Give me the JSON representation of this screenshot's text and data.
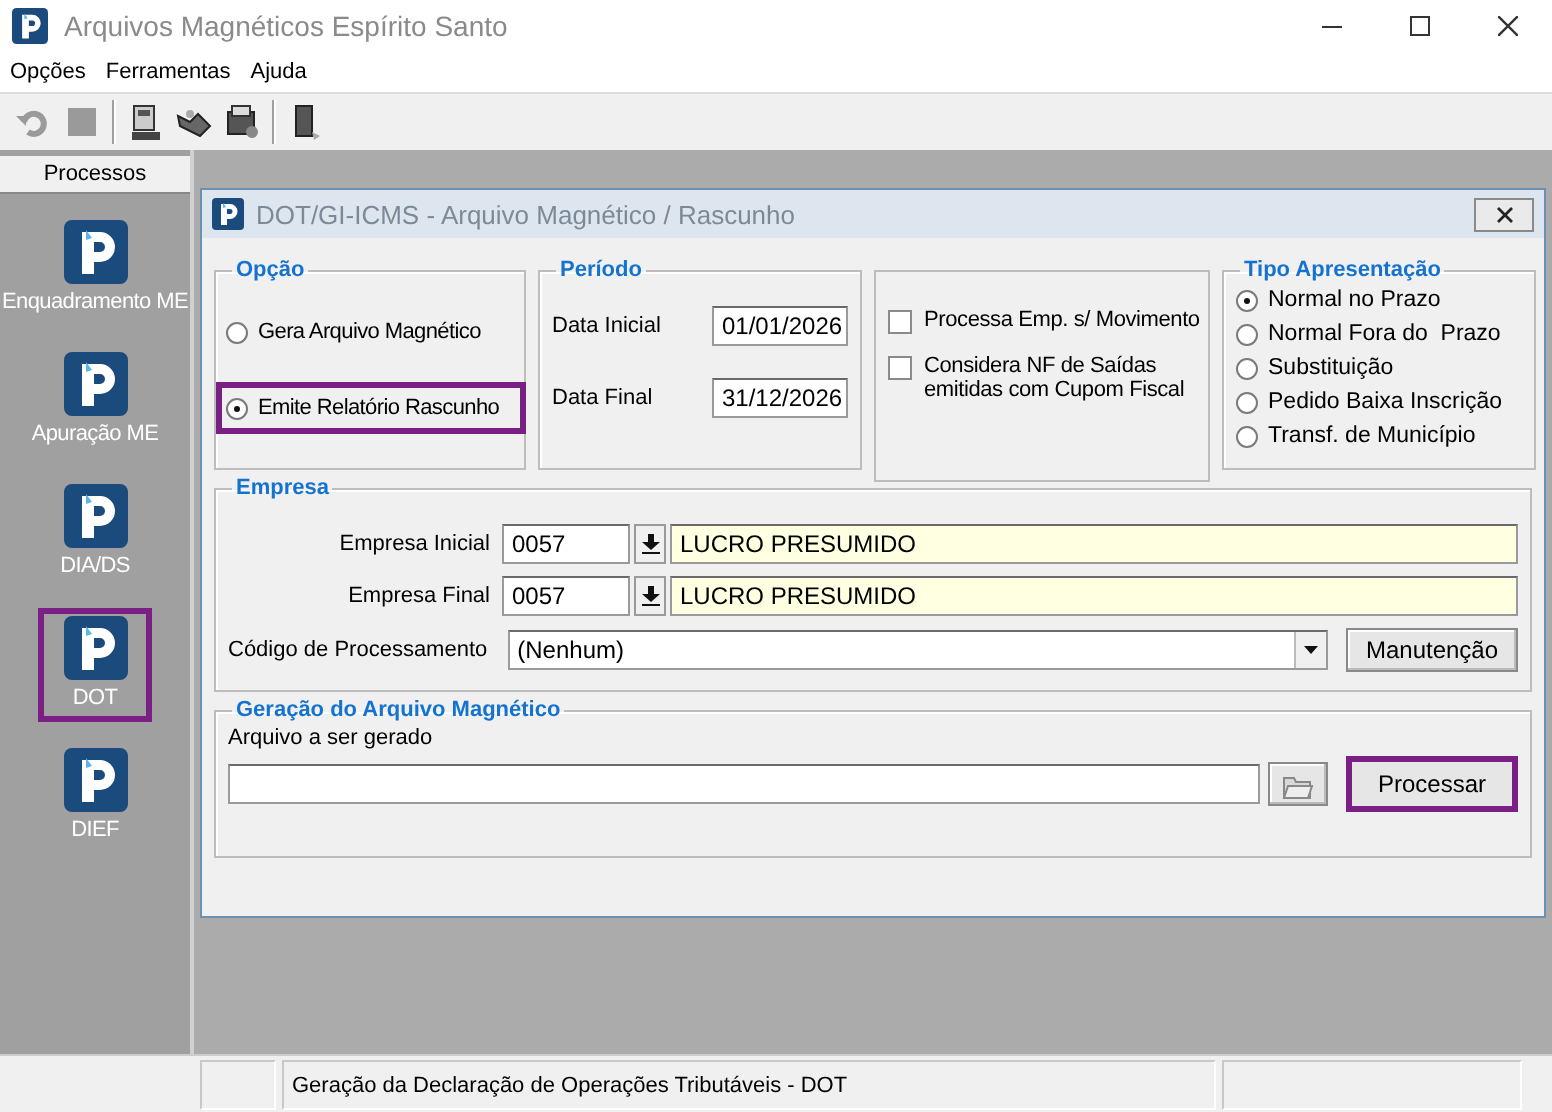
{
  "window": {
    "title": "Arquivos Magnéticos Espírito Santo"
  },
  "menu": [
    "Opções",
    "Ferramentas",
    "Ajuda"
  ],
  "sidebar": {
    "title": "Processos",
    "items": [
      {
        "label": "Enquadramento ME",
        "highlighted": false
      },
      {
        "label": "Apuração ME",
        "highlighted": false
      },
      {
        "label": "DIA/DS",
        "highlighted": false
      },
      {
        "label": "DOT",
        "highlighted": true
      },
      {
        "label": "DIEF",
        "highlighted": false
      }
    ]
  },
  "dialog": {
    "title": "DOT/GI-ICMS - Arquivo Magnético / Rascunho",
    "opcao": {
      "title": "Opção",
      "options": [
        {
          "label": "Gera Arquivo  Magnético",
          "selected": false,
          "highlighted": false
        },
        {
          "label": "Emite Relatório Rascunho",
          "selected": true,
          "highlighted": true
        }
      ]
    },
    "periodo": {
      "title": "Período",
      "fields": [
        {
          "label": "Data Inicial",
          "value": "01/01/2026"
        },
        {
          "label": "Data Final",
          "value": "31/12/2026"
        }
      ]
    },
    "flags": [
      {
        "label": "Processa Emp. s/ Movimento",
        "checked": false
      },
      {
        "label": "Considera NF de Saídas emitidas com Cupom Fiscal",
        "checked": false
      }
    ],
    "tipo": {
      "title": "Tipo Apresentação",
      "options": [
        {
          "label": "Normal no Prazo",
          "selected": true
        },
        {
          "label": "Normal Fora do  Prazo",
          "selected": false
        },
        {
          "label": "Substituição",
          "selected": false
        },
        {
          "label": "Pedido Baixa Inscrição",
          "selected": false
        },
        {
          "label": "Transf. de Município",
          "selected": false
        }
      ]
    },
    "empresa": {
      "title": "Empresa",
      "rows": [
        {
          "label": "Empresa Inicial",
          "code": "0057",
          "name": "LUCRO PRESUMIDO"
        },
        {
          "label": "Empresa Final",
          "code": "0057",
          "name": "LUCRO PRESUMIDO"
        }
      ],
      "processing": {
        "label": "Código de Processamento",
        "value": "(Nenhum)"
      },
      "maintenance_button": "Manutenção"
    },
    "geracao": {
      "title": "Geração do Arquivo Magnético",
      "file_label": "Arquivo a ser gerado",
      "process_button": {
        "label": "Processar",
        "highlighted": true
      }
    }
  },
  "status_bar": [
    "Geração da Declaração de Operações Tributáveis - DOT"
  ]
}
